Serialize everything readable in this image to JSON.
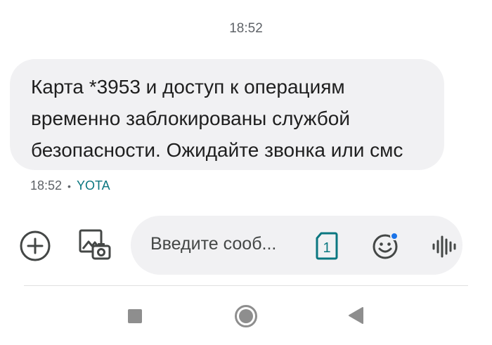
{
  "conversation": {
    "time_header": "18:52",
    "message": {
      "lines": [
        "Карта *3953 и доступ к операциям",
        "временно заблокированы службой",
        "безопасности. Ожидайте звонка или смс"
      ],
      "time": "18:52",
      "separator": "•",
      "sender": "YOTA"
    }
  },
  "composer": {
    "placeholder": "Введите сооб...",
    "sim_slot": "1",
    "icons": {
      "add": "add-circle-icon",
      "gallery": "gallery-camera-icon",
      "sim": "sim-card-icon",
      "emoji": "emoji-icon",
      "voice": "voice-waveform-icon"
    }
  },
  "nav_bar": {
    "icons": [
      "recents-square-icon",
      "home-circle-icon",
      "back-triangle-icon"
    ]
  },
  "colors": {
    "bubble_bg": "#f1f1f3",
    "sender_accent": "#0b7780",
    "sim_accent": "#0b7780",
    "emoji_badge": "#1a73e8",
    "icon_gray": "#444746",
    "nav_gray": "#8e8e8e"
  }
}
